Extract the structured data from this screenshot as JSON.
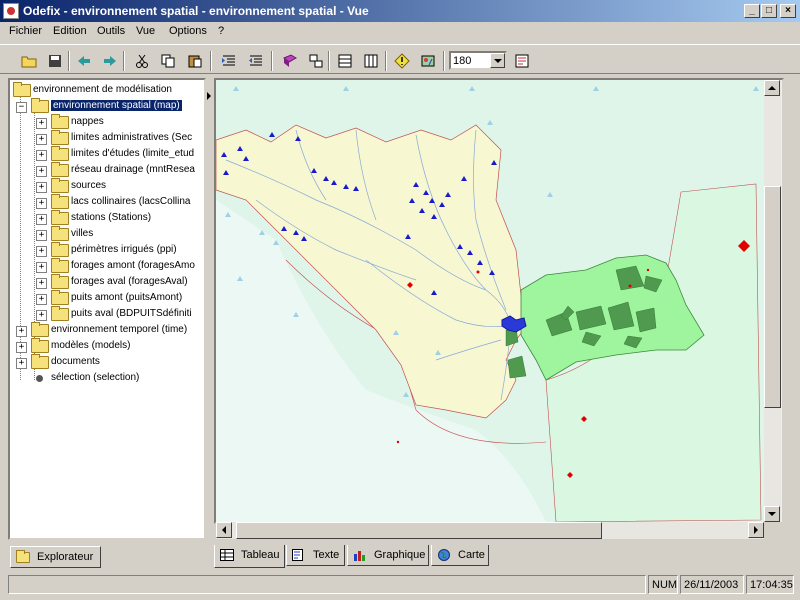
{
  "window": {
    "title": "Odefix - environnement spatial - environnement spatial - Vue"
  },
  "menu": [
    "Fichier",
    "Edition",
    "Outils",
    "Vue",
    "Options",
    "?"
  ],
  "toolbar": {
    "buttons": [
      "open-folder-icon",
      "save-icon",
      "back-arrow-icon",
      "forward-arrow-icon",
      "cut-icon",
      "copy-icon",
      "paste-icon",
      "indent-icon",
      "outdent-icon",
      "book-icon",
      "layers-icon",
      "table-icon",
      "columns-icon",
      "warning-icon",
      "map-tool-icon"
    ],
    "zoom_value": "180",
    "extra_button": "properties-icon"
  },
  "explorer": {
    "root": "environnement de modélisation",
    "selected": "environnement spatial (map)",
    "layers": [
      "nappes",
      "limites administratives (Sec",
      "limites d'études (limite_etud",
      "réseau drainage (mntResea",
      "sources",
      "lacs collinaires (lacsCollina",
      "stations (Stations)",
      "villes",
      "périmètres irrigués (ppi)",
      "forages amont (foragesAmo",
      "forages aval (foragesAval)",
      "puits amont (puitsAmont)",
      "puits aval (BDPUITSdéfiniti"
    ],
    "others": [
      "environnement temporel (time)",
      "modèles (models)",
      "documents"
    ],
    "selection": "sélection (selection)",
    "tab": "Explorateur"
  },
  "view_tabs": [
    "Tableau",
    "Texte",
    "Graphique",
    "Carte"
  ],
  "status": {
    "num": "NUM",
    "date": "26/11/2003",
    "time": "17:04:35"
  },
  "colors": {
    "selection": "#0a246a",
    "basin": "#f7f7d2",
    "irrigated": "#9ef59e",
    "wells": "#1a1acc",
    "points": "#e00000"
  }
}
